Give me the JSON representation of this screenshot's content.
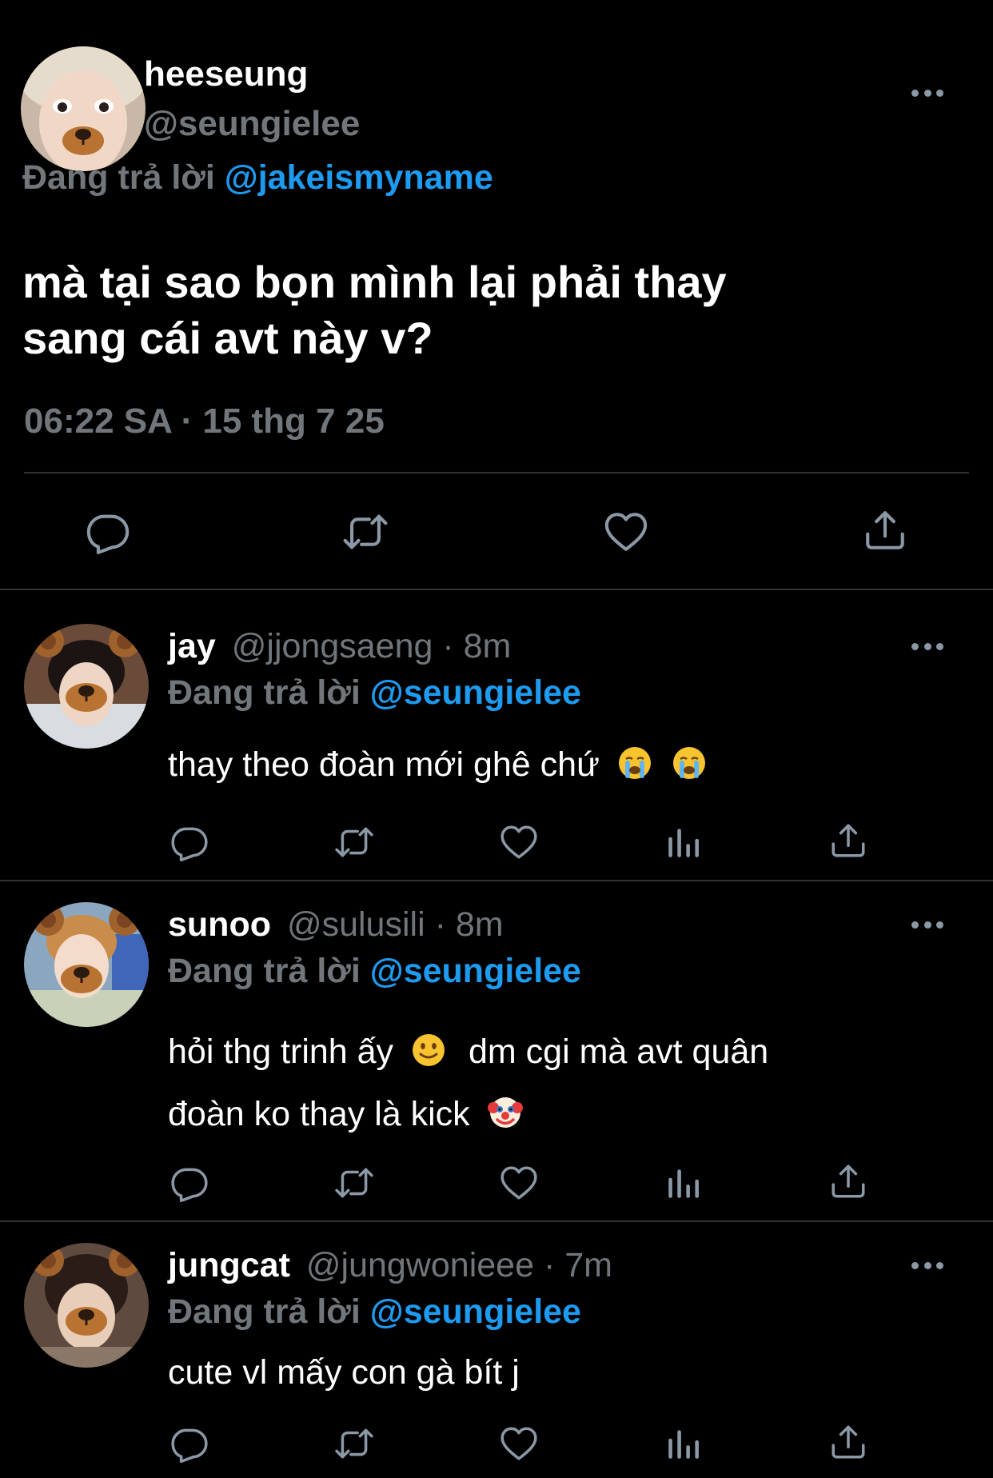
{
  "main_tweet": {
    "display_name": "heeseung",
    "handle": "@seungielee",
    "replying_prefix": "Đang trả lời",
    "replying_to": "@jakeismyname",
    "text_line1": "mà tại sao bọn mình lại phải thay",
    "text_line2": "sang cái avt này v?",
    "timestamp": "06:22 SA · 15 thg 7 25",
    "actions": [
      "reply-icon",
      "retweet-icon",
      "like-icon",
      "share-icon"
    ]
  },
  "replies": [
    {
      "display_name": "jay",
      "handle": "@jjongsaeng",
      "time": "· 8m",
      "replying_prefix": "Đang trả lời",
      "replying_to": "@seungielee",
      "text_line1": "thay theo đoàn mới ghê chứ",
      "emojis": [
        "loudly-crying-face-emoji",
        "loudly-crying-face-emoji"
      ]
    },
    {
      "display_name": "sunoo",
      "handle": "@sulusili",
      "time": "· 8m",
      "replying_prefix": "Đang trả lời",
      "replying_to": "@seungielee",
      "text_line1a": "hỏi thg trinh ấy",
      "text_line1b": "dm cgi mà avt quân",
      "text_line2": "đoàn ko thay là kick",
      "emojis": [
        "slightly-smiling-face-emoji",
        "clown-face-emoji"
      ]
    },
    {
      "display_name": "jungcat",
      "handle": "@jungwonieee",
      "time": "· 7m",
      "replying_prefix": "Đang trả lời",
      "replying_to": "@seungielee",
      "text_line1": "cute vl mấy con gà bít j"
    }
  ],
  "colors": {
    "background": "#000000",
    "text": "#ffffff",
    "secondary": "#71767b",
    "link": "#1d9bf0",
    "divider": "#2f3336"
  }
}
